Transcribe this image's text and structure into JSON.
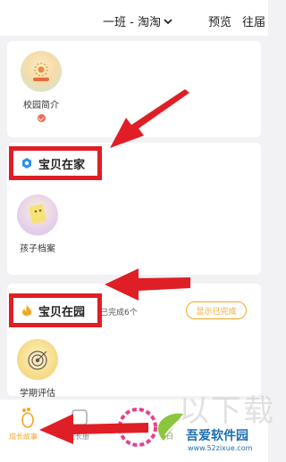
{
  "header": {
    "class_name": "一班 - 淘淘",
    "preview_label": "预览",
    "past_label": "往届"
  },
  "campus": {
    "intro_label": "校园简介"
  },
  "home_section": {
    "title": "宝贝在家",
    "archive_label": "孩子档案"
  },
  "school_section": {
    "title": "宝贝在园",
    "completed_count": "已完成6个",
    "show_completed_button": "显示已完成",
    "assessment_label": "学期评估"
  },
  "bottom_nav": {
    "story": "成长故事",
    "album": "成长册",
    "partial": "日"
  },
  "watermark": {
    "name": "吾爱软件园",
    "url": "www.52zixue.com"
  },
  "colors": {
    "annotation_red": "#e01e25",
    "accent_orange": "#f5a623",
    "home_icon_blue": "#2b8ff0"
  }
}
